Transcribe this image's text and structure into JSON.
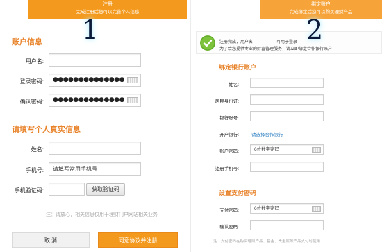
{
  "step1": {
    "number": "1",
    "banner_title": "注册",
    "banner_subtitle": "完成注册后您可以完善个人信息",
    "account_section_title": "账户信息",
    "username_label": "用户名:",
    "login_password_label": "登录密码:",
    "login_password_value": "●●●●●●●●●●●●●●",
    "confirm_password_label": "确认密码:",
    "confirm_password_value": "●●●●●●●●●●●●●●",
    "real_info_section_title": "请填写个人真实信息",
    "name_label": "姓名:",
    "mobile_label": "手机号:",
    "mobile_placeholder": "请填写常用手机号",
    "sms_code_label": "手机验证码:",
    "get_code_button": "获取验证码",
    "note": "注：请放心，相关信息仅用于理财门户网站相关业务",
    "cancel_button": "取 消",
    "submit_button": "同意协议并注册"
  },
  "step2": {
    "number": "2",
    "banner_title": "绑定账户",
    "banner_subtitle": "完成绑定后您可以购买理财产品",
    "success_msg_line1": "注册完成，用户名",
    "success_msg_line1b": "可用于登录",
    "success_msg_line2": "为了给您提供专业的财富管理服务，请立即绑定合作银行账户",
    "bind_bank_title": "绑定银行账户",
    "name_label": "姓名:",
    "id_card_label": "居民身份证:",
    "bank_account_label": "银行账号:",
    "open_bank_label": "开户银行:",
    "open_bank_link": "请选择合作银行",
    "account_password_label": "账户密码:",
    "account_password_placeholder": "6位数字密码",
    "registered_mobile_label": "注册手机号:",
    "pay_password_title": "设置支付密码",
    "pay_password_label": "支付密码:",
    "pay_password_placeholder": "6位数字密码",
    "confirm_label": "确认密码:",
    "note": "注：支付密码在购买理财产品、基金、贵金属等产品支付时使用"
  },
  "colors": {
    "accent_orange": "#f39a1e",
    "section_title": "#e8832a",
    "link_blue": "#2d7fc2",
    "success_green": "#7cc23a"
  }
}
